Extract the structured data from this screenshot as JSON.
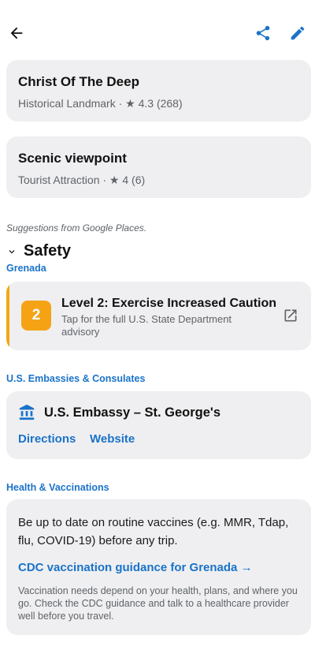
{
  "colors": {
    "accent": "#1a73c9",
    "card_bg": "#efeff1",
    "warning": "#f5a315"
  },
  "topbar": {
    "back_icon": "arrow-left-icon",
    "share_icon": "share-icon",
    "edit_icon": "pencil-icon"
  },
  "places": [
    {
      "name": "Christ Of The Deep",
      "subtitle": "Historical Landmark · ★ 4.3 (268)"
    },
    {
      "name": "Scenic viewpoint",
      "subtitle": "Tourist Attraction · ★ 4 (6)"
    }
  ],
  "suggestions_note": "Suggestions from Google Places.",
  "safety": {
    "title": "Safety",
    "country": "Grenada",
    "advisory": {
      "level": "2",
      "title": "Level 2: Exercise Increased Caution",
      "subtitle": "Tap for the full U.S. State Department advisory"
    }
  },
  "embassies": {
    "label": "U.S. Embassies & Consulates",
    "name": "U.S. Embassy – St. George's",
    "directions_label": "Directions",
    "website_label": "Website"
  },
  "health": {
    "label": "Health & Vaccinations",
    "main_text": "Be up to date on routine vaccines (e.g. MMR, Tdap, flu, COVID-19) before any trip.",
    "link_text": "CDC vaccination guidance for Grenada →",
    "note": "Vaccination needs depend on your health, plans, and where you go. Check the CDC guidance and talk to a healthcare provider well before you travel."
  }
}
